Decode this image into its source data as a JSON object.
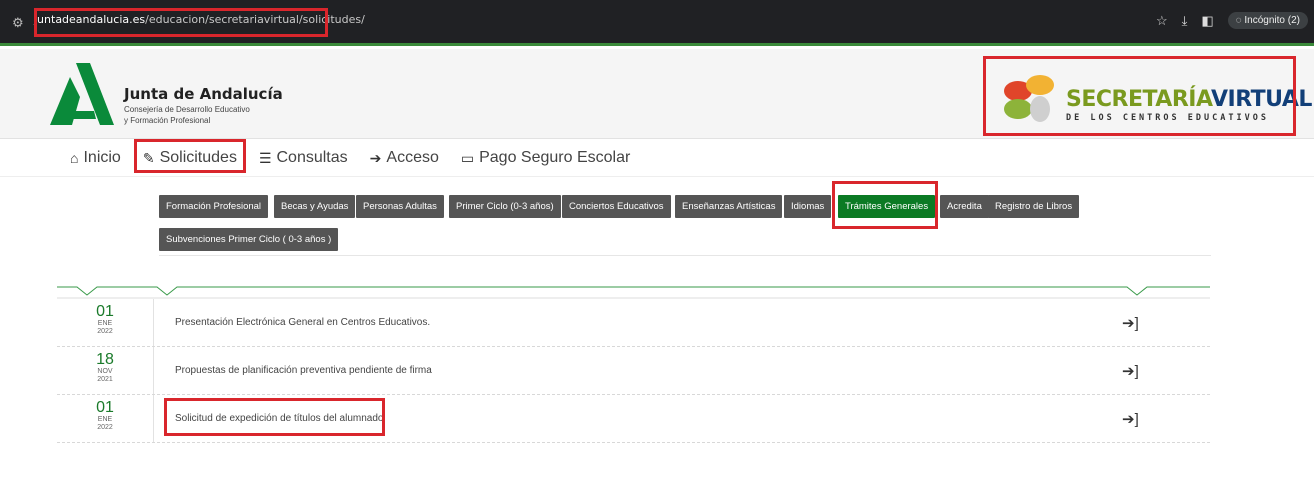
{
  "browser": {
    "url_domain": "juntadeandalucia.es",
    "url_path": "/educacion/secretariavirtual/solicitudes/",
    "incognito_label": "Incógnito (2)"
  },
  "header": {
    "org_title": "Junta de Andalucía",
    "org_sub1": "Consejería de Desarrollo Educativo",
    "org_sub2": "y Formación Profesional",
    "sv_title_a": "SECRETARÍA",
    "sv_title_b": "VIRTUAL",
    "sv_subtitle": "DE LOS CENTROS EDUCATIVOS"
  },
  "nav": {
    "items": [
      {
        "label": "Inicio",
        "icon": "home-icon"
      },
      {
        "label": "Solicitudes",
        "icon": "pencil-icon"
      },
      {
        "label": "Consultas",
        "icon": "list-icon"
      },
      {
        "label": "Acceso",
        "icon": "sign-in-icon"
      },
      {
        "label": "Pago Seguro Escolar",
        "icon": "credit-card-icon"
      }
    ]
  },
  "categories": [
    "Formación Profesional",
    "Becas y Ayudas",
    "Personas Adultas",
    "Primer Ciclo (0-3 años)",
    "Conciertos Educativos",
    "Enseñanzas Artísticas",
    "Idiomas",
    "Trámites Generales",
    "Acredita",
    "Registro de Libros",
    "Subvenciones Primer Ciclo ( 0-3 años )"
  ],
  "active_category": "Trámites Generales",
  "rows": [
    {
      "day": "01",
      "month": "ENE",
      "year": "2022",
      "text": "Presentación Electrónica General en Centros Educativos."
    },
    {
      "day": "18",
      "month": "NOV",
      "year": "2021",
      "text": "Propuestas de planificación preventiva pendiente de firma"
    },
    {
      "day": "01",
      "month": "ENE",
      "year": "2022",
      "text": "Solicitud de expedición de títulos del alumnado"
    }
  ],
  "colors": {
    "active_green": "#0b7a24",
    "button_gray": "#555555",
    "highlight_red": "#d9262c"
  }
}
